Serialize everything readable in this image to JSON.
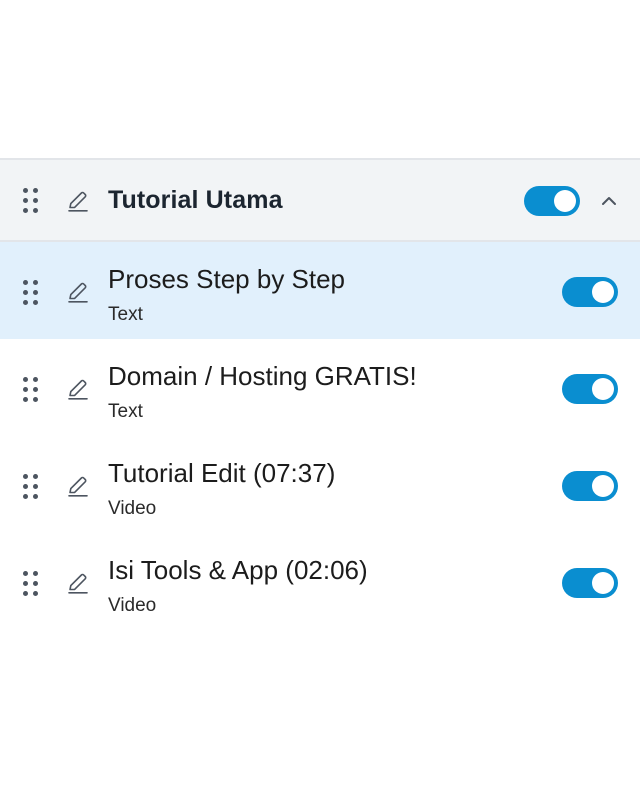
{
  "section": {
    "title": "Tutorial Utama",
    "enabled": true,
    "expanded": true,
    "icons": {
      "drag": "drag-handle-icon",
      "edit": "pencil-icon",
      "collapse": "chevron-up-icon"
    }
  },
  "items": [
    {
      "title": "Proses Step by Step",
      "type": "Text",
      "enabled": true,
      "selected": true
    },
    {
      "title": "Domain / Hosting GRATIS!",
      "type": "Text",
      "enabled": true,
      "selected": false
    },
    {
      "title": "Tutorial Edit (07:37)",
      "type": "Video",
      "enabled": true,
      "selected": false
    },
    {
      "title": "Isi Tools & App (02:06)",
      "type": "Video",
      "enabled": true,
      "selected": false
    }
  ],
  "colors": {
    "toggle_on": "#0a8ed0",
    "header_bg": "#f2f4f6",
    "selected_bg": "#e1f0fc"
  }
}
